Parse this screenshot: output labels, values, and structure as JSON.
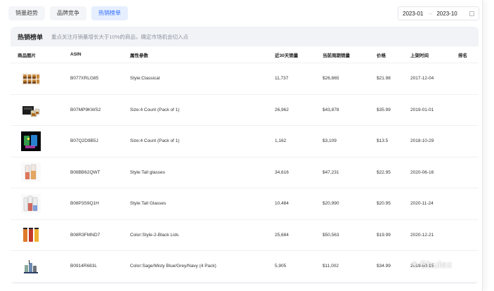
{
  "tabs": [
    {
      "label": "销量趋势",
      "active": false
    },
    {
      "label": "品牌竞争",
      "active": false
    },
    {
      "label": "热销榜单",
      "active": true
    }
  ],
  "date_range": {
    "start": "2023-01",
    "separator": "→",
    "end": "2023-10"
  },
  "panel": {
    "title": "热销榜单",
    "subtitle": "重点关注月销量增长大于10%的商品，确定市场机会切入点"
  },
  "table": {
    "headers": [
      "商品图片",
      "ASIN",
      "属性参数",
      "近30天销量",
      "当前周期销量",
      "价格",
      "上架时间",
      "排名"
    ],
    "rows": [
      {
        "thumb": "whisky-glass-set-icon",
        "asin": "B077XRLG85",
        "attr": "Style:Classical",
        "sales30": "11,737",
        "period": "$26,865",
        "price": "$21.98",
        "date": "2017-12-04",
        "rank": ""
      },
      {
        "thumb": "glass-gift-box-icon",
        "asin": "B07MP9KWS2",
        "attr": "Size:4 Count (Pack of 1)",
        "sales30": "26,962",
        "period": "$43,878",
        "price": "$35.99",
        "date": "2019-01-01",
        "rank": ""
      },
      {
        "thumb": "led-glass-icon",
        "asin": "B07Q2D9B5J",
        "attr": "Size:4 Count (Pack of 1)",
        "sales30": "1,162",
        "period": "$3,109",
        "price": "$13.5",
        "date": "2018-10-29",
        "rank": ""
      },
      {
        "thumb": "tall-glasses-icon",
        "asin": "B08BB62QWT",
        "attr": "Style:Tall glasses",
        "sales30": "34,616",
        "period": "$47,231",
        "price": "$22.95",
        "date": "2020-06-16",
        "rank": ""
      },
      {
        "thumb": "tall-glasses-set-icon",
        "asin": "B08P3S9Q1H",
        "attr": "Style:Tall Glasses",
        "sales30": "10,484",
        "period": "$20,990",
        "price": "$20.95",
        "date": "2020-11-24",
        "rank": ""
      },
      {
        "thumb": "tumbler-lids-icon",
        "asin": "B08R3FMND7",
        "attr": "Color:Style-2-Black Lids",
        "sales30": "25,684",
        "period": "$50,563",
        "price": "$19.99",
        "date": "2020-12-21",
        "rank": ""
      },
      {
        "thumb": "tumbler-set-icon",
        "asin": "B0914R683L",
        "attr": "Color:Sage/Misty Blue/Grey/Navy (4 Pack)",
        "sales30": "5,905",
        "period": "$11,002",
        "price": "$34.99",
        "date": "2019-08-15",
        "rank": ""
      }
    ]
  },
  "watermark": {
    "text": "Shulex",
    "icon": "wechat-icon"
  }
}
